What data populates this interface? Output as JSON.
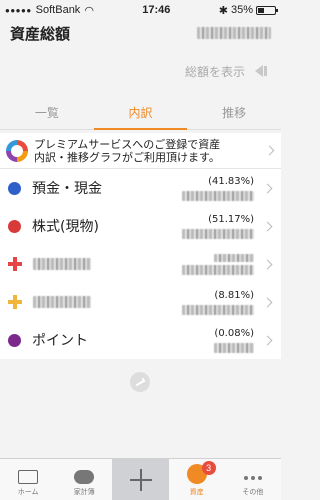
{
  "status_bar": {
    "carrier": "SoftBank",
    "time": "17:46",
    "battery": "35%",
    "battery_level": 0.35
  },
  "header": {
    "title": "資産総額"
  },
  "show_total": {
    "label": "総額を表示"
  },
  "tabs": [
    {
      "label": "一覧",
      "active": false
    },
    {
      "label": "内訳",
      "active": true
    },
    {
      "label": "推移",
      "active": false
    }
  ],
  "banner": {
    "text_line1": "プレミアムサービスへのご登録で資産",
    "text_line2": "内訳・推移グラフがご利用頂けます。"
  },
  "assets": [
    {
      "name": "預金・現金",
      "percent": "(41.83%)",
      "color": "#2f5fc9"
    },
    {
      "name": "株式(現物)",
      "percent": "(51.17%)",
      "color": "#d83a3a"
    },
    {
      "name": "",
      "percent": "",
      "color": "#e64545"
    },
    {
      "name": "",
      "percent": "(8.81%)",
      "color": "#f2b53b"
    },
    {
      "name": "ポイント",
      "percent": "(0.08%)",
      "color": "#7b2a8c"
    }
  ],
  "tabbar": {
    "home": "ホーム",
    "budget": "家計簿",
    "assets": "資産",
    "assets_badge": "3",
    "more": "その他"
  },
  "colors": {
    "accent": "#f08a24",
    "badge": "#e74c3c"
  }
}
